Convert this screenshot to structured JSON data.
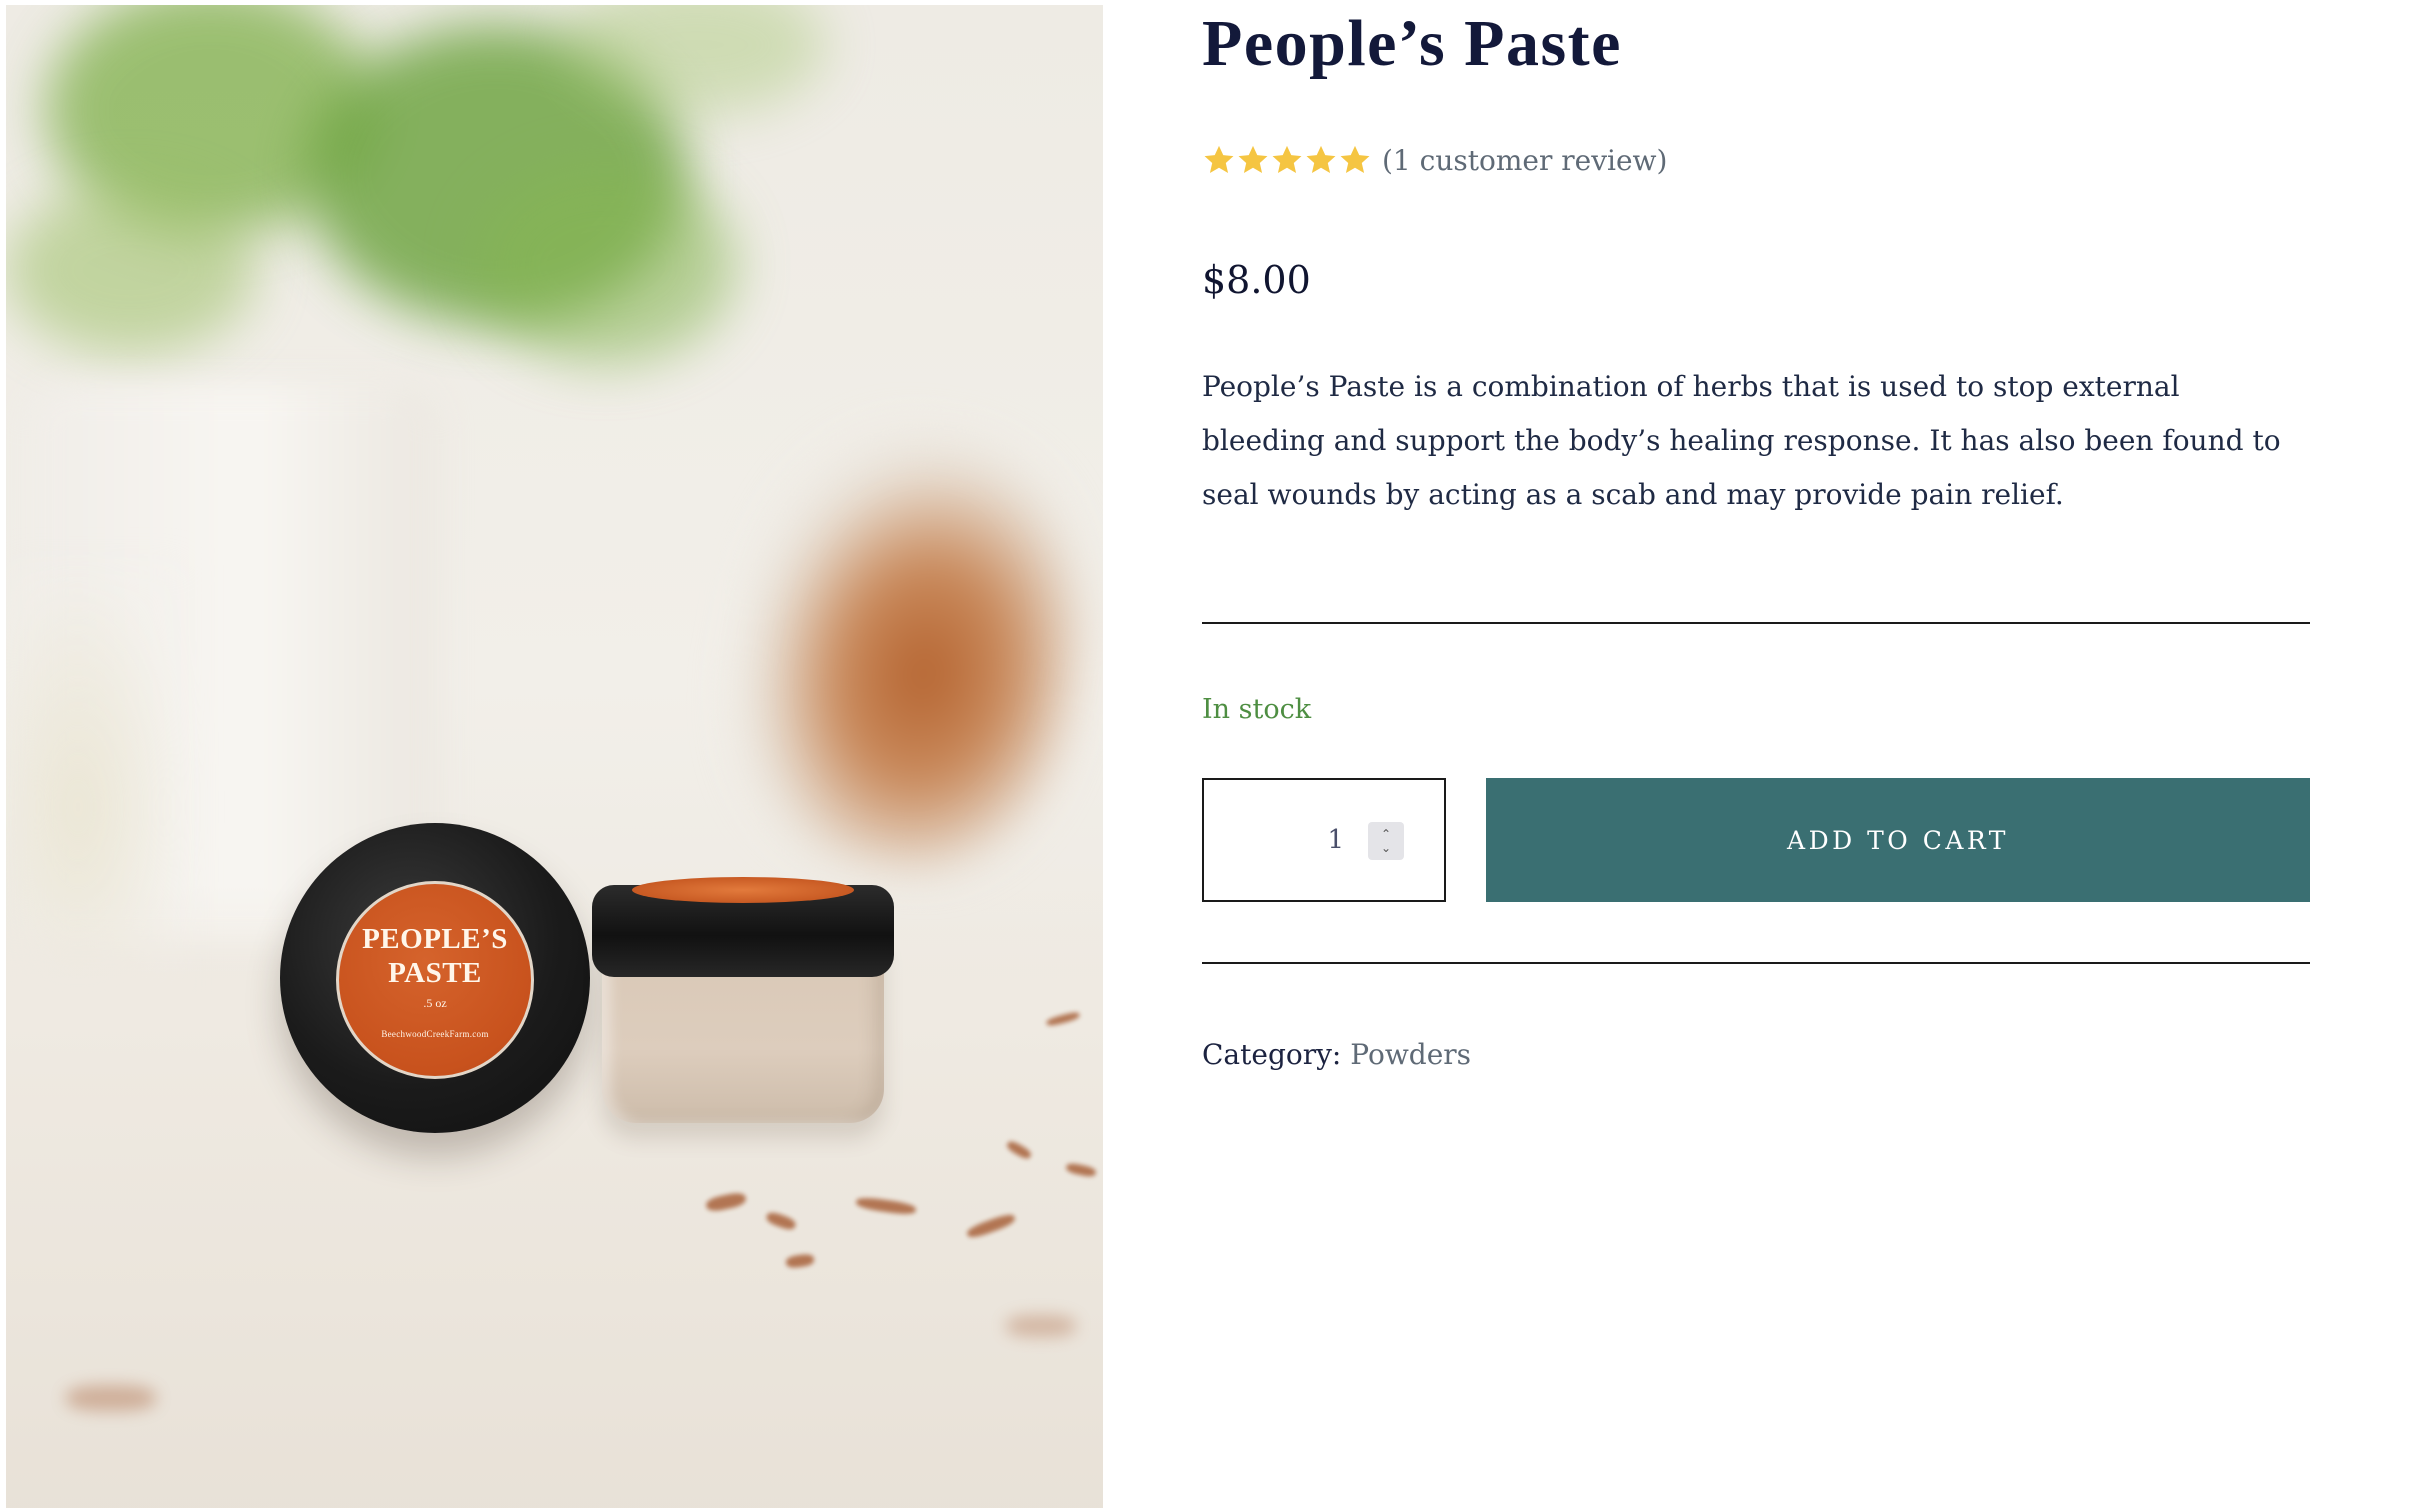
{
  "product": {
    "title": "People’s Paste",
    "rating": {
      "stars": 5,
      "max_stars": 5,
      "review_link_text": "(1 customer review)",
      "star_color": "#f5c542"
    },
    "price": "$8.00",
    "description": "People’s Paste is a combination of herbs that is used to stop external bleeding and support the body’s healing response. It has also been found to seal wounds by acting as a scab and may provide pain relief.",
    "stock_status": "In stock",
    "stock_color": "#4e8e42",
    "quantity": "1",
    "add_to_cart_label": "ADD TO CART",
    "button_color": "#3a6f72",
    "category_label": "Category:",
    "category_value": "Powders"
  },
  "image": {
    "label_title_line1": "PEOPLE’S",
    "label_title_line2": "PASTE",
    "label_size": ".5 oz",
    "label_url": "BeechwoodCreekFarm.com"
  },
  "icons": {
    "star": "star-icon",
    "spinner_up": "chevron-up-icon",
    "spinner_down": "chevron-down-icon"
  }
}
